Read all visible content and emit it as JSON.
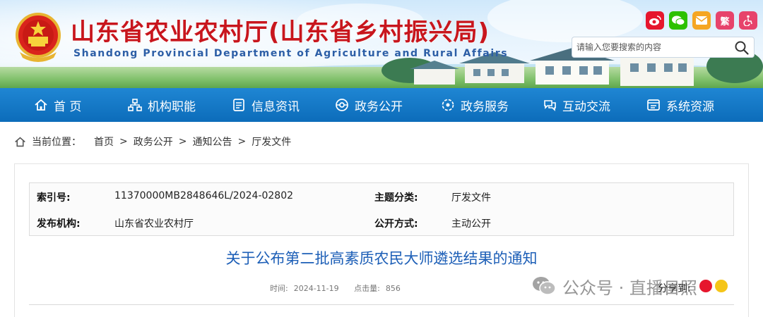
{
  "header": {
    "title_cn": "山东省农业农村厅(山东省乡村振兴局)",
    "title_en": "Shandong Provincial Department of Agriculture and Rural Affairs",
    "share_icons": [
      {
        "name": "weibo-icon",
        "color": "#e6162d",
        "glyph": "微"
      },
      {
        "name": "wechat-icon",
        "color": "#2dc100",
        "glyph": "信"
      },
      {
        "name": "email-icon",
        "color": "#f5a623",
        "glyph": "✉"
      },
      {
        "name": "traditional-chinese-icon",
        "color": "#e7436b",
        "glyph": "繁"
      },
      {
        "name": "accessibility-icon",
        "color": "#e7436b",
        "glyph": "♿"
      }
    ],
    "search_placeholder": "请输入您要搜索的内容"
  },
  "nav": {
    "items": [
      {
        "label": "首 页",
        "icon": "home-icon"
      },
      {
        "label": "机构职能",
        "icon": "org-structure-icon"
      },
      {
        "label": "信息资讯",
        "icon": "document-icon"
      },
      {
        "label": "政务公开",
        "icon": "open-government-icon"
      },
      {
        "label": "政务服务",
        "icon": "service-icon"
      },
      {
        "label": "互动交流",
        "icon": "chat-icon"
      },
      {
        "label": "系统资源",
        "icon": "system-resource-icon"
      }
    ]
  },
  "breadcrumb": {
    "label": "当前位置：",
    "items": [
      "首页",
      "政务公开",
      "通知公告",
      "厅发文件"
    ],
    "separator": ">"
  },
  "meta": {
    "index_key": "索引号:",
    "index_value": "11370000MB2848646L/2024-02802",
    "topic_key": "主题分类:",
    "topic_value": "厅发文件",
    "publisher_key": "发布机构:",
    "publisher_value": "山东省农业农村厅",
    "disclosure_key": "公开方式:",
    "disclosure_value": "主动公开"
  },
  "article": {
    "title": "关于公布第二批高素质农民大师遴选结果的通知",
    "time_label": "时间:",
    "time_value": "2024-11-19",
    "views_label": "点击量:",
    "views_value": "856",
    "share_label": "分享到:"
  },
  "watermark": {
    "text": "公众号 · 直播日照"
  },
  "colors": {
    "nav_bg": "#0c6cba",
    "title_red": "#c8161d",
    "title_blue": "#1d5fb7"
  }
}
